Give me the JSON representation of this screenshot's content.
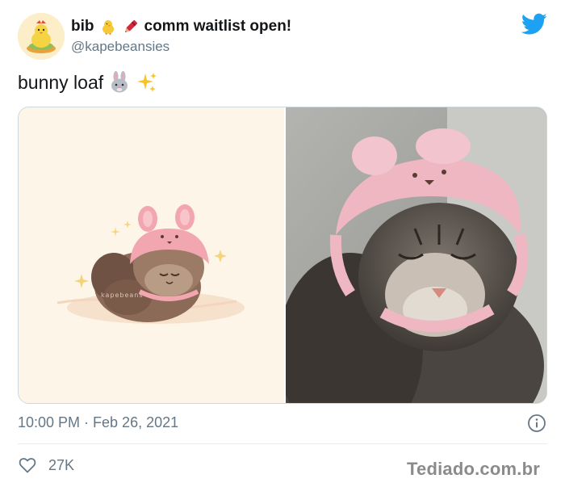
{
  "user": {
    "display_name_pre": "bib",
    "display_name_post": "comm waitlist open!",
    "handle": "@kapebeansies",
    "name_emojis": [
      "chick-icon",
      "crayon-icon"
    ]
  },
  "tweet": {
    "text": "bunny loaf",
    "text_emojis": [
      "rabbit-face-icon",
      "sparkles-icon"
    ],
    "media": {
      "left_image": "illustration-cat-with-bunny-hat",
      "left_signature": "kapebeans",
      "right_image": "photo-cat-with-pink-bunny-hat"
    },
    "timestamp": "10:00 PM · Feb 26, 2021",
    "like_count": "27K"
  },
  "colors": {
    "twitter_blue": "#1da1f2",
    "text_primary": "#14171a",
    "text_secondary": "#657786",
    "border": "#ccd6dd"
  },
  "watermark": "Tediado.com.br"
}
